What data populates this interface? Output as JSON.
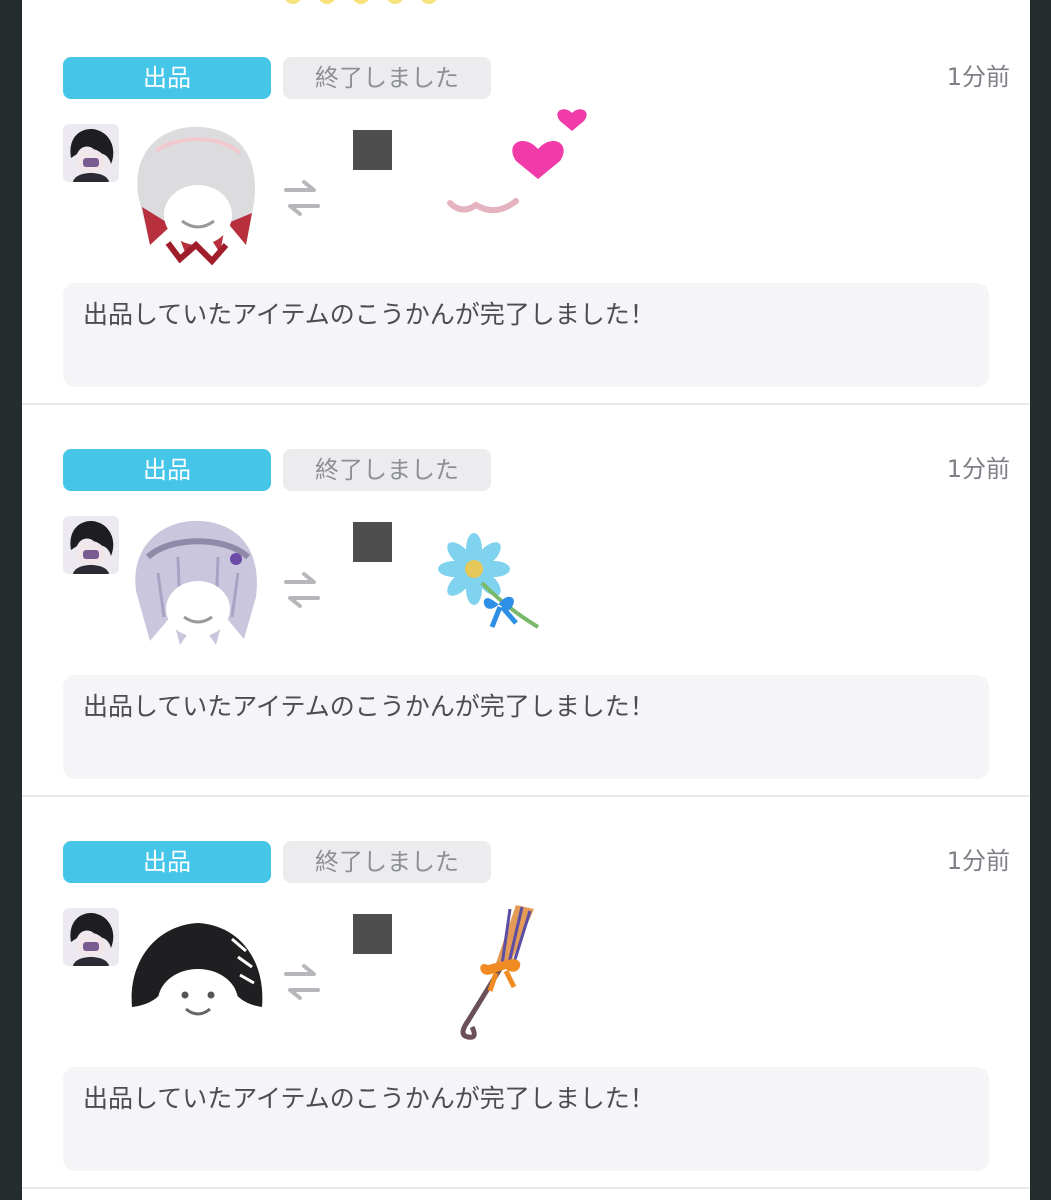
{
  "colors": {
    "type_tag": "#45c5e8",
    "status_tag": "#ececef",
    "message_bg": "#f5f5f7",
    "divider": "#e9eaec",
    "side_background": "#252c2e"
  },
  "notifications": [
    {
      "type_label": "出品",
      "status_label": "終了しました",
      "time": "1分前",
      "message": "出品していたアイテムのこうかんが完了しました！",
      "given_item_icon": "white-red-hair-icon",
      "received_item_icon": "hearts-smile-icon"
    },
    {
      "type_label": "出品",
      "status_label": "終了しました",
      "time": "1分前",
      "message": "出品していたアイテムのこうかんが完了しました！",
      "given_item_icon": "lavender-hair-icon",
      "received_item_icon": "blue-flower-icon"
    },
    {
      "type_label": "出品",
      "status_label": "終了しました",
      "time": "1分前",
      "message": "出品していたアイテムのこうかんが完了しました！",
      "given_item_icon": "black-hood-icon",
      "received_item_icon": "witch-broom-icon"
    }
  ]
}
